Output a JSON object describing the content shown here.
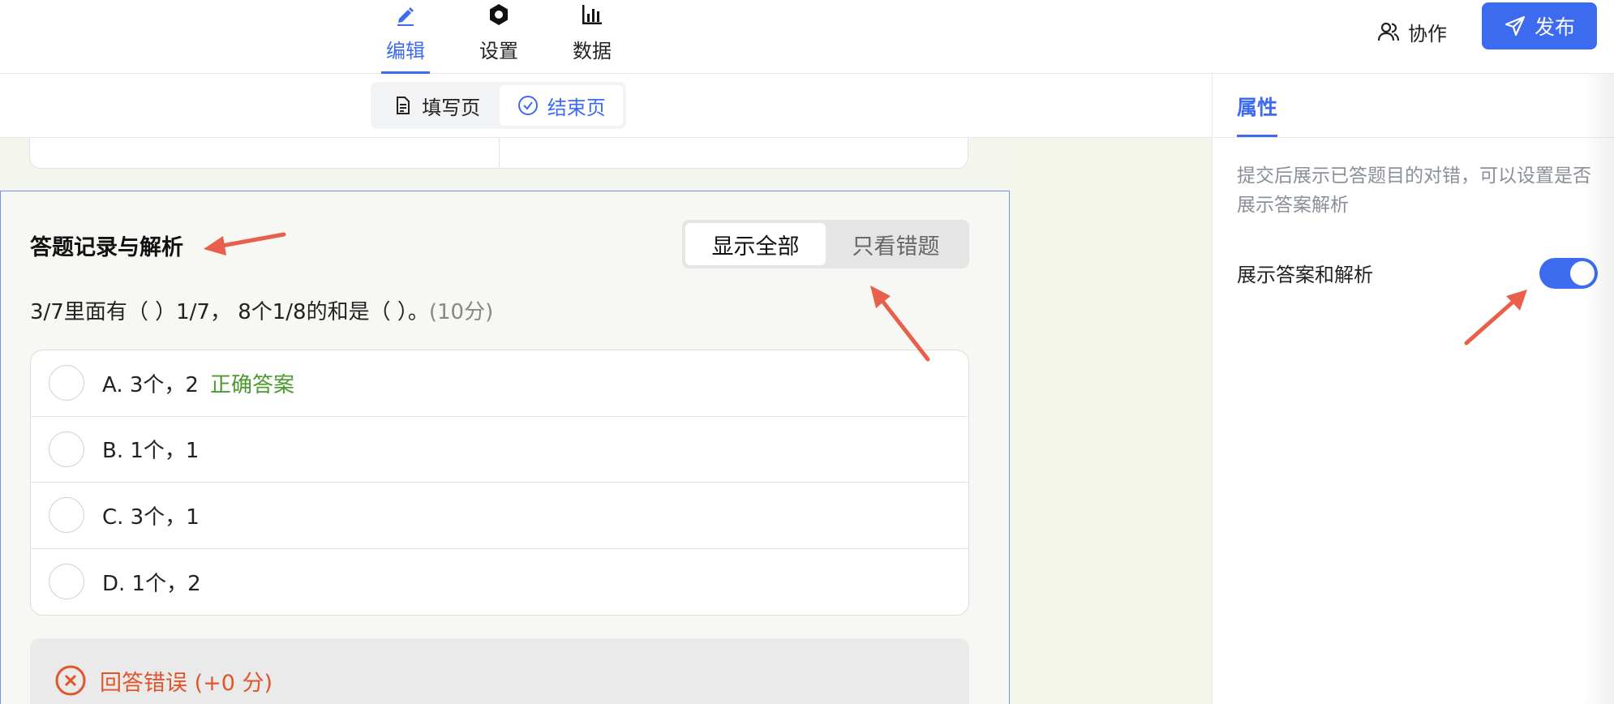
{
  "topnav": {
    "tabs": [
      {
        "label": "编辑",
        "icon": "pencil-icon",
        "active": true
      },
      {
        "label": "设置",
        "icon": "hexagon-settings-icon",
        "active": false
      },
      {
        "label": "数据",
        "icon": "bar-chart-icon",
        "active": false
      }
    ],
    "collab_label": "协作",
    "publish_label": "发布"
  },
  "page_toggle": {
    "fill_label": "填写页",
    "end_label": "结束页",
    "selected": "结束页"
  },
  "section": {
    "title": "答题记录与解析",
    "filter": {
      "all_label": "显示全部",
      "wrong_label": "只看错题",
      "selected": "显示全部"
    },
    "question": {
      "text": "3/7里面有（ ）1/7， 8个1/8的和是（ ）。",
      "score": "(10分)",
      "options": [
        {
          "label": "A. 3个，2",
          "tag": "正确答案"
        },
        {
          "label": "B. 1个，1",
          "tag": ""
        },
        {
          "label": "C. 3个，1",
          "tag": ""
        },
        {
          "label": "D. 1个，2",
          "tag": ""
        }
      ]
    },
    "result_label": "回答错误 (+0 分)"
  },
  "panel": {
    "tab_label": "属性",
    "description": "提交后展示已答题目的对错，可以设置是否展示答案解析",
    "setting_label": "展示答案和解析",
    "setting_enabled": true
  },
  "colors": {
    "accent": "#3d6bf0",
    "correct": "#4b9a2d",
    "error": "#e0552a",
    "annotation": "#e8604c"
  }
}
